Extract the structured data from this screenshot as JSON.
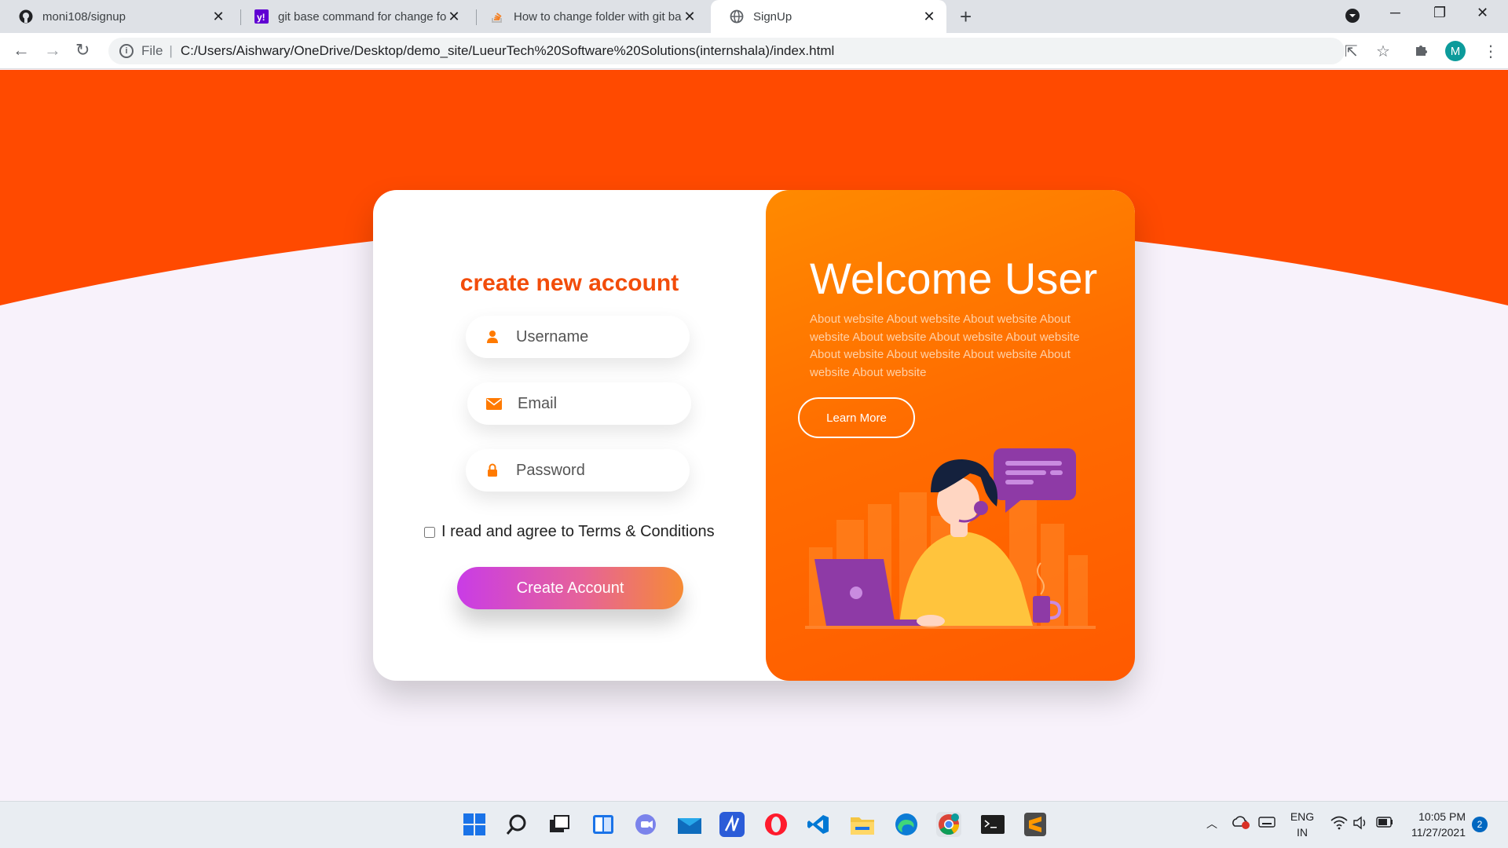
{
  "browser": {
    "tabs": [
      {
        "title": "moni108/signup",
        "icon": "github-icon"
      },
      {
        "title": "git base command for change fo",
        "icon": "yahoo-icon"
      },
      {
        "title": "How to change folder with git ba",
        "icon": "stackoverflow-icon"
      },
      {
        "title": "SignUp",
        "icon": "globe-icon"
      }
    ],
    "active_tab": 3,
    "url_scheme": "File",
    "url": "C:/Users/Aishwary/OneDrive/Desktop/demo_site/LueurTech%20Software%20Solutions(internshala)/index.html",
    "profile_initial": "M"
  },
  "colors": {
    "accent": "#ff4a00",
    "panel_orange": "#ff6d00",
    "page_bg": "#f8f2fb",
    "title": "#f24c0a"
  },
  "form": {
    "title": "create new account",
    "username_placeholder": "Username",
    "email_placeholder": "Email",
    "password_placeholder": "Password",
    "terms_label": "I read and agree to Terms & Conditions",
    "terms_checked": false,
    "submit_label": "Create Account"
  },
  "panel": {
    "heading": "Welcome User",
    "about_text": "About website About website About website About website About website About website About website About website About website About website About website About website",
    "learn_more_label": "Learn More"
  },
  "taskbar": {
    "apps": [
      "windows-start-icon",
      "search-icon",
      "task-view-icon",
      "widgets-icon",
      "teams-chat-icon",
      "mail-icon",
      "whiteboard-icon",
      "opera-icon",
      "vscode-icon",
      "file-explorer-icon",
      "edge-icon",
      "chrome-icon",
      "terminal-icon",
      "sublime-icon"
    ],
    "language": "ENG",
    "region": "IN",
    "time": "10:05 PM",
    "date": "11/27/2021",
    "notifications": "2"
  }
}
